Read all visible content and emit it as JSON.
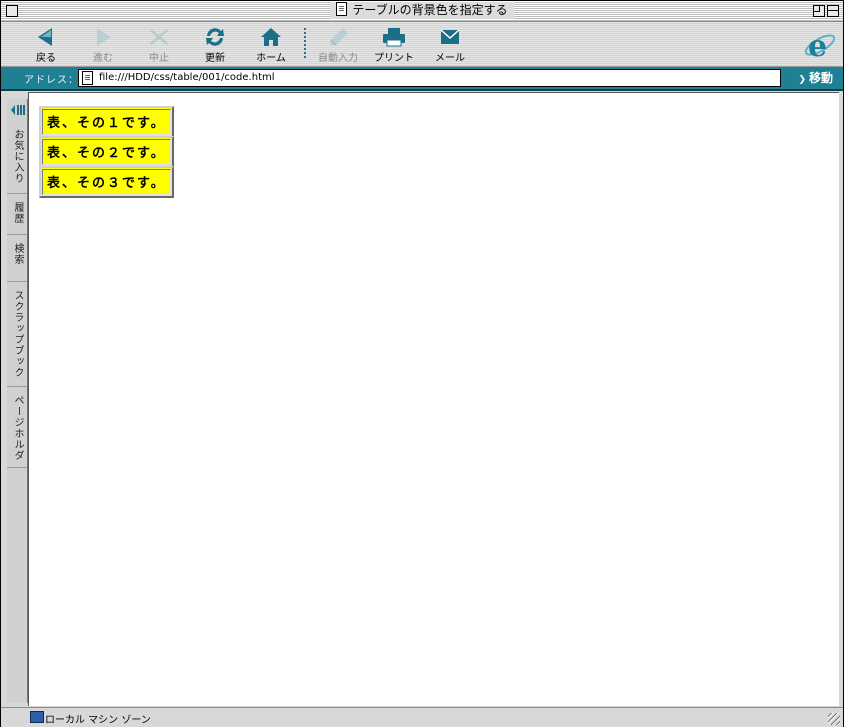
{
  "window": {
    "title": "テーブルの背景色を指定する"
  },
  "toolbar": {
    "buttons": [
      {
        "label": "戻る",
        "icon": "back-arrow-icon",
        "enabled": true
      },
      {
        "label": "進む",
        "icon": "forward-arrow-icon",
        "enabled": false
      },
      {
        "label": "中止",
        "icon": "stop-x-icon",
        "enabled": false
      },
      {
        "label": "更新",
        "icon": "refresh-icon",
        "enabled": true
      },
      {
        "label": "ホーム",
        "icon": "home-icon",
        "enabled": true
      },
      {
        "label": "自動入力",
        "icon": "autofill-pen-icon",
        "enabled": false
      },
      {
        "label": "プリント",
        "icon": "printer-icon",
        "enabled": true
      },
      {
        "label": "メール",
        "icon": "mail-envelope-icon",
        "enabled": true
      }
    ]
  },
  "address": {
    "label": "アドレス：",
    "url": "file:///HDD/css/table/001/code.html",
    "go_label": "移動"
  },
  "sidebar": {
    "tabs": [
      "お気に入り",
      "履歴",
      "検索",
      "スクラップブック",
      "ページホルダ"
    ]
  },
  "page": {
    "tables": [
      "表、その１です。",
      "表、その２です。",
      "表、その３です。"
    ],
    "table_bg": "#fffe00"
  },
  "status": {
    "zone": "ローカル マシン ゾーン"
  },
  "colors": {
    "accent": "#1f7f93",
    "icon_teal": "#1d6f88"
  }
}
